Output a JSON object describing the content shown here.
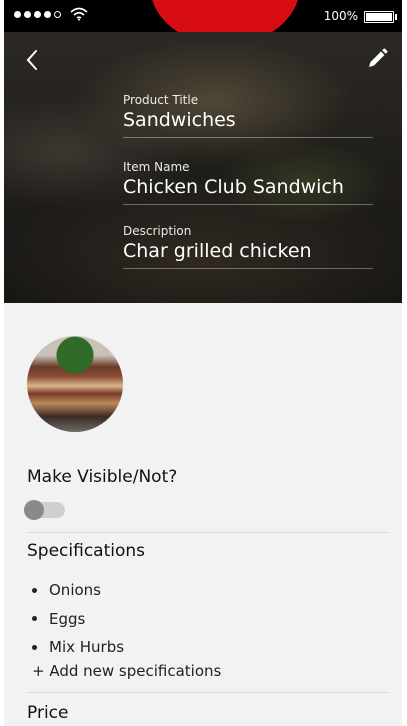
{
  "status_bar": {
    "battery_text": "100%",
    "signal_bars_filled": 4,
    "signal_bars_total": 5
  },
  "hero": {
    "back_icon": "chevron-left-icon",
    "edit_icon": "pencil-icon",
    "product_title_label": "Product Title",
    "product_title_value": "Sandwiches",
    "item_name_label": "Item Name",
    "item_name_value": "Chicken Club Sandwich",
    "description_label": "Description",
    "description_value": "Char grilled chicken"
  },
  "visibility": {
    "label": "Make Visible/Not?",
    "enabled": false
  },
  "specifications": {
    "title": "Specifications",
    "items": [
      "Onions",
      "Eggs",
      "Mix Hurbs"
    ],
    "add_label": "+ Add new specifications"
  },
  "price": {
    "title": "Price"
  },
  "colors": {
    "accent_red": "#d80d14",
    "background": "#f2f2f2"
  }
}
